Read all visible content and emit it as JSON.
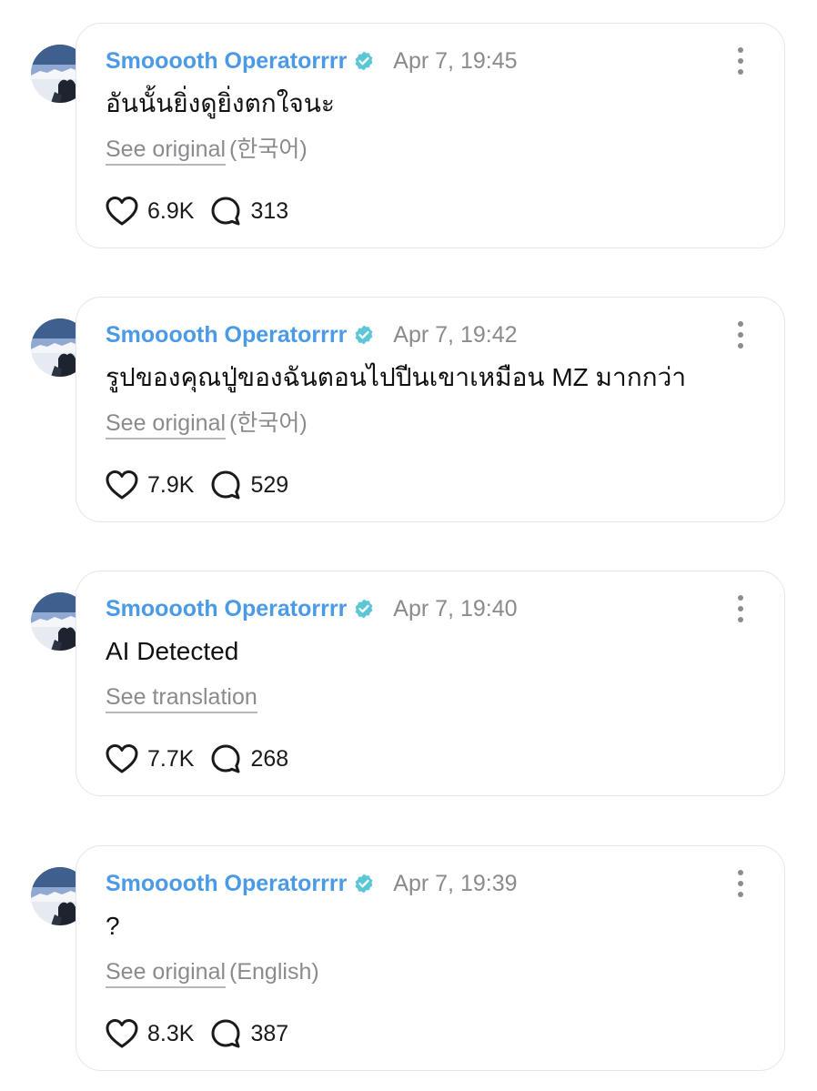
{
  "comments": [
    {
      "username": "Smooooth Operatorrrr",
      "timestamp": "Apr 7, 19:45",
      "text": "อันนั้นยิ่งดูยิ่งตกใจนะ",
      "translate_link": "See original",
      "translate_lang": "(한국어)",
      "likes": "6.9K",
      "replies": "313"
    },
    {
      "username": "Smooooth Operatorrrr",
      "timestamp": "Apr 7, 19:42",
      "text": "รูปของคุณปู่ของฉันตอนไปปีนเขาเหมือน MZ มากกว่า",
      "translate_link": "See original",
      "translate_lang": "(한국어)",
      "likes": "7.9K",
      "replies": "529"
    },
    {
      "username": "Smooooth Operatorrrr",
      "timestamp": "Apr 7, 19:40",
      "text": "AI Detected",
      "translate_link": "See translation",
      "translate_lang": "",
      "likes": "7.7K",
      "replies": "268"
    },
    {
      "username": "Smooooth Operatorrrr",
      "timestamp": "Apr 7, 19:39",
      "text": "?",
      "translate_link": "See original",
      "translate_lang": "(English)",
      "likes": "8.3K",
      "replies": "387"
    }
  ],
  "icons": {
    "verified": "verified-badge-icon",
    "more": "more-vertical-icon",
    "like": "heart-icon",
    "reply": "comment-bubble-icon"
  },
  "colors": {
    "username": "#4a9ae6",
    "verified_badge": "#5bc7d6",
    "muted_text": "#8b8b8f",
    "card_border": "#e4e6eb"
  }
}
